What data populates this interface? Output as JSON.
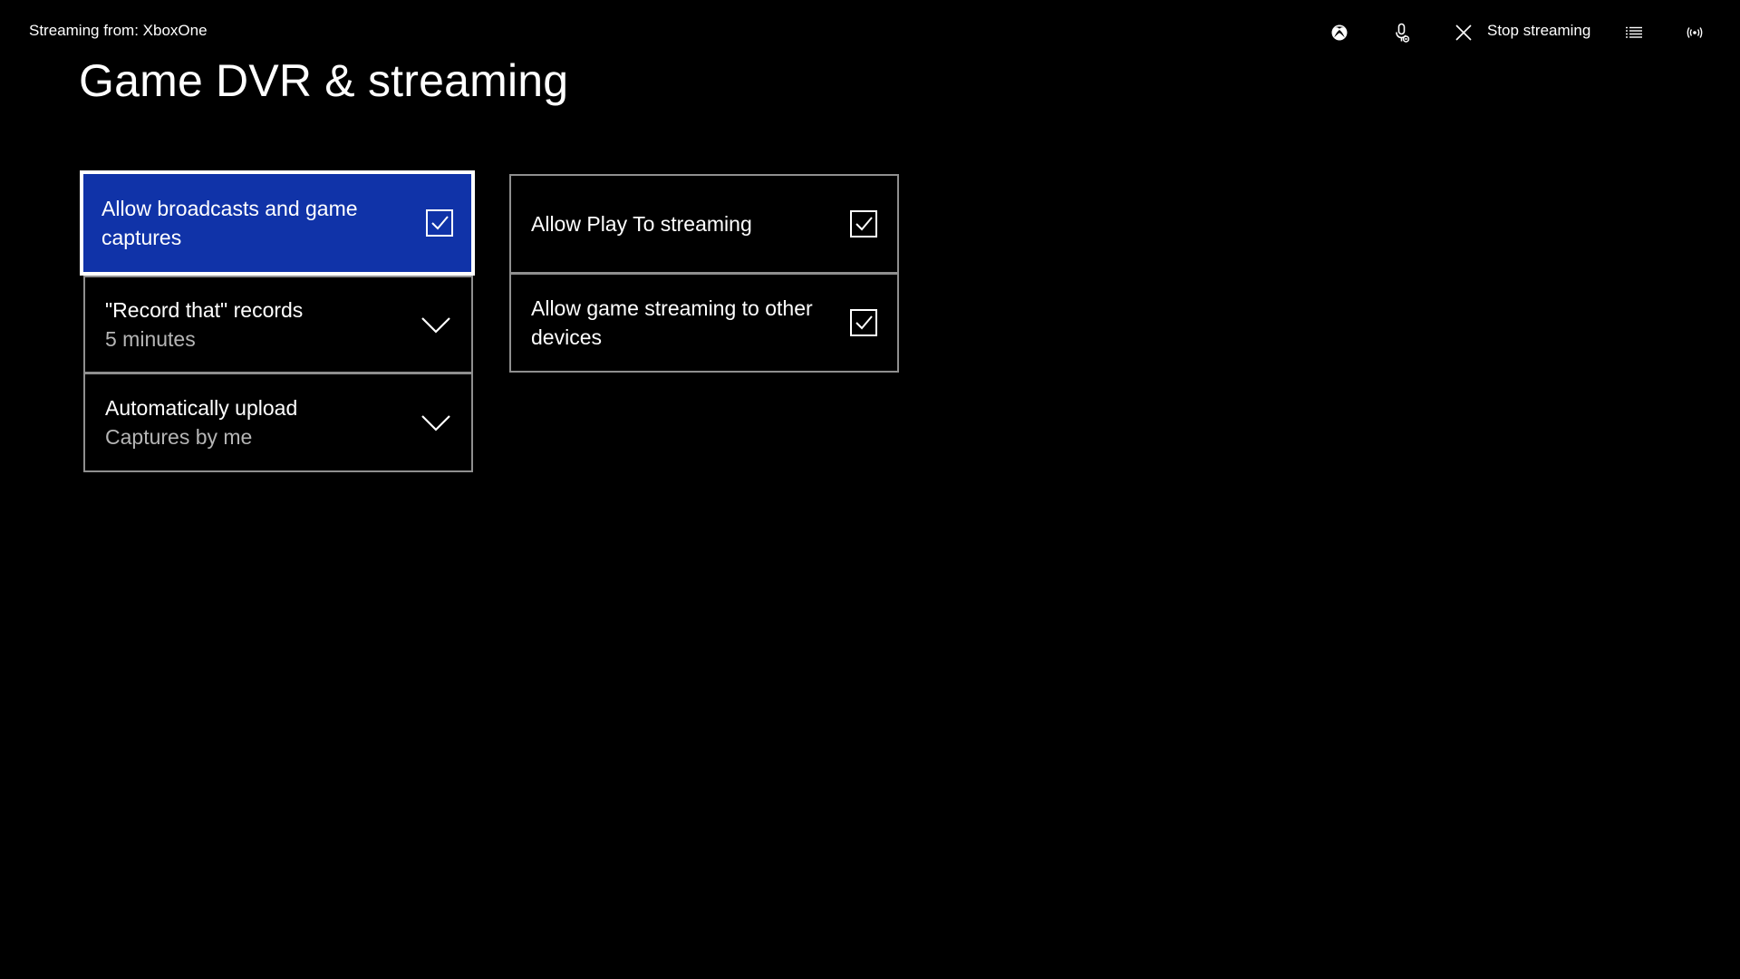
{
  "topbar": {
    "source_text": "Streaming from: XboxOne",
    "icons": [
      "xbox-logo-icon",
      "microphone-icon",
      "close-icon",
      "menu-icon",
      "broadcast-icon"
    ],
    "stop_label": "Stop streaming"
  },
  "page": {
    "title": "Game DVR & streaming"
  },
  "settings": {
    "left": [
      {
        "label": "Allow broadcasts and game captures",
        "type": "checkbox",
        "checked": true,
        "selected": true
      },
      {
        "label": "\"Record that\" records",
        "value": "5 minutes",
        "type": "dropdown"
      },
      {
        "label": "Automatically upload",
        "value": "Captures by me",
        "type": "dropdown"
      }
    ],
    "right": [
      {
        "label": "Allow Play To streaming",
        "type": "checkbox",
        "checked": true
      },
      {
        "label": "Allow game streaming to other devices",
        "type": "checkbox",
        "checked": true
      }
    ]
  },
  "colors": {
    "background": "#000000",
    "selected_tile": "#1033a8",
    "tile_border": "#8f8f8f",
    "secondary_text": "#b5b5b5"
  }
}
